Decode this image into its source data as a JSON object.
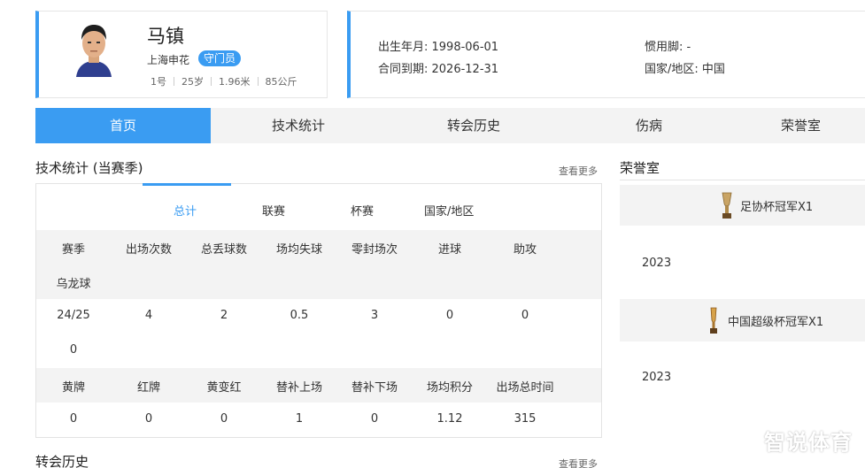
{
  "player": {
    "name": "马镇",
    "club": "上海申花",
    "position": "守门员",
    "number": "1号",
    "age": "25岁",
    "height": "1.96米",
    "weight": "85公斤"
  },
  "info": {
    "birth": "出生年月: 1998-06-01",
    "contract": "合同到期: 2026-12-31",
    "foot": "惯用脚: -",
    "nation": "国家/地区: 中国"
  },
  "nav": {
    "tabs": [
      "首页",
      "技术统计",
      "转会历史",
      "伤病",
      "荣誉室"
    ]
  },
  "stats": {
    "title": "技术统计 (当赛季)",
    "more": "查看更多",
    "sub_tabs": [
      "总计",
      "联赛",
      "杯赛",
      "国家/地区"
    ],
    "header1": [
      "赛季",
      "出场次数",
      "总丢球数",
      "场均失球",
      "零封场次",
      "进球",
      "助攻",
      "乌龙球"
    ],
    "row1": [
      "24/25",
      "4",
      "2",
      "0.5",
      "3",
      "0",
      "0",
      "0"
    ],
    "header2": [
      "黄牌",
      "红牌",
      "黄变红",
      "替补上场",
      "替补下场",
      "场均积分",
      "出场总时间"
    ],
    "row2": [
      "0",
      "0",
      "0",
      "1",
      "0",
      "1.12",
      "315"
    ]
  },
  "transfer": {
    "title": "转会历史",
    "more": "查看更多"
  },
  "honors": {
    "title": "荣誉室",
    "items": [
      {
        "name": "足协杯冠军X1",
        "year": "2023"
      },
      {
        "name": "中国超级杯冠军X1",
        "year": "2023"
      }
    ]
  },
  "watermark": "智说体育",
  "colors": {
    "accent": "#3a9cf2",
    "band": "#f3f3f3"
  }
}
